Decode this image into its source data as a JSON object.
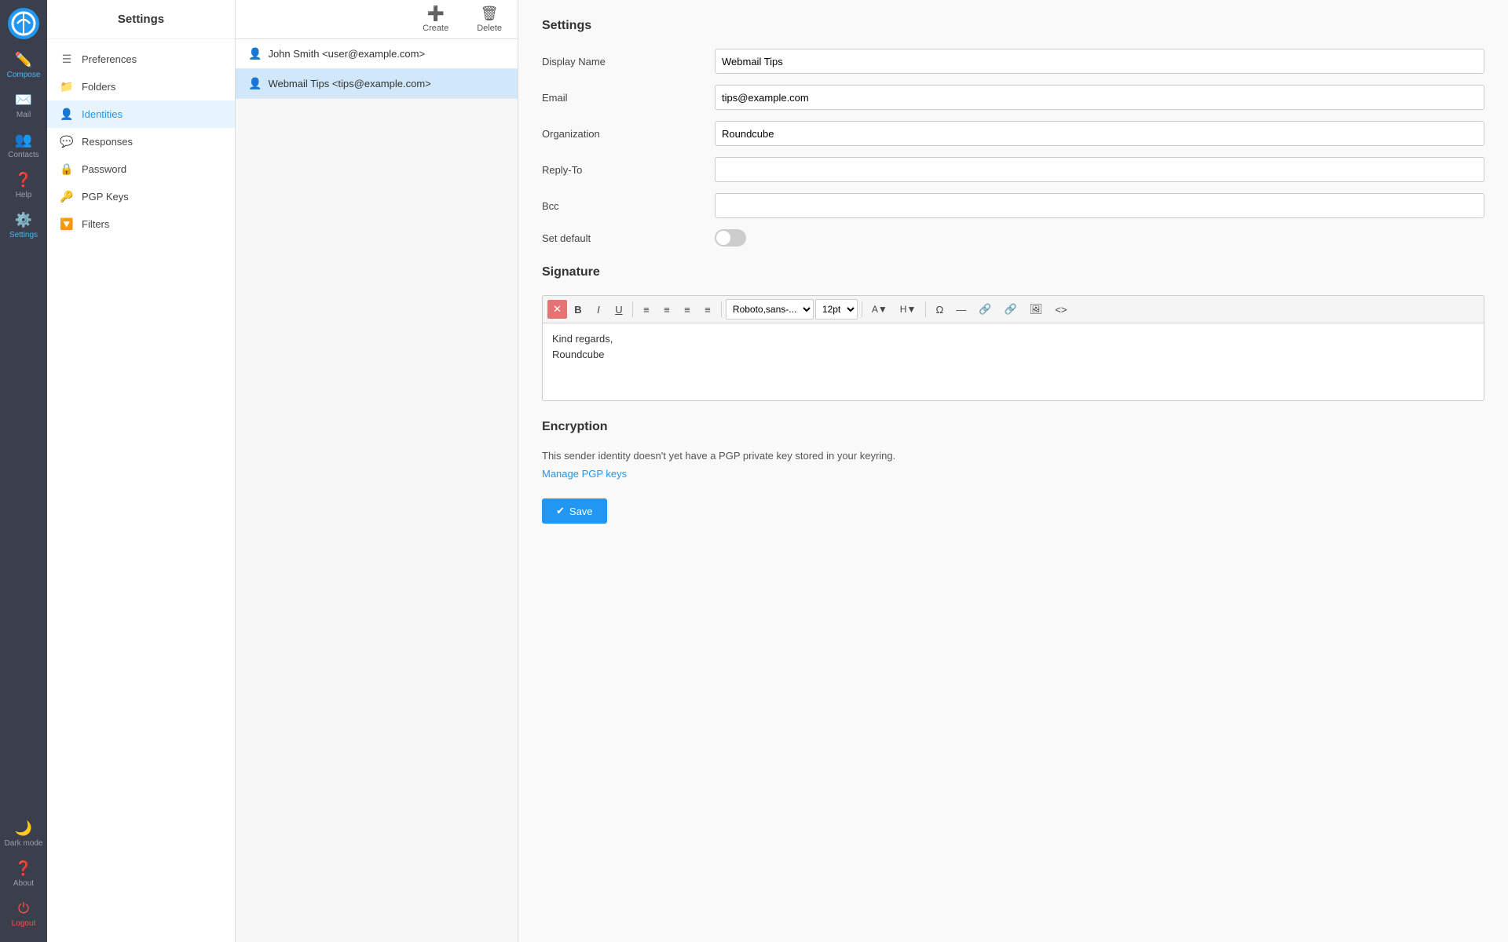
{
  "app": {
    "logo_alt": "Roundcube"
  },
  "left_nav": {
    "items": [
      {
        "id": "compose",
        "label": "Compose",
        "icon": "✏️",
        "active": false
      },
      {
        "id": "mail",
        "label": "Mail",
        "icon": "✉️",
        "active": false
      },
      {
        "id": "contacts",
        "label": "Contacts",
        "icon": "👥",
        "active": false
      },
      {
        "id": "help",
        "label": "Help",
        "icon": "❓",
        "active": false
      },
      {
        "id": "settings",
        "label": "Settings",
        "icon": "⚙️",
        "active": true
      }
    ],
    "bottom_items": [
      {
        "id": "darkmode",
        "label": "Dark mode",
        "icon": "🌙"
      },
      {
        "id": "about",
        "label": "About",
        "icon": "❓"
      },
      {
        "id": "logout",
        "label": "Logout",
        "icon": "⏻"
      }
    ]
  },
  "sidebar": {
    "title": "Settings",
    "menu_items": [
      {
        "id": "preferences",
        "label": "Preferences",
        "icon": "☰",
        "active": false
      },
      {
        "id": "folders",
        "label": "Folders",
        "icon": "📁",
        "active": false
      },
      {
        "id": "identities",
        "label": "Identities",
        "icon": "👤",
        "active": true
      },
      {
        "id": "responses",
        "label": "Responses",
        "icon": "💬",
        "active": false
      },
      {
        "id": "password",
        "label": "Password",
        "icon": "🔒",
        "active": false
      },
      {
        "id": "pgp_keys",
        "label": "PGP Keys",
        "icon": "🔑",
        "active": false
      },
      {
        "id": "filters",
        "label": "Filters",
        "icon": "🔽",
        "active": false
      }
    ]
  },
  "identity_panel": {
    "toolbar": {
      "create_label": "Create",
      "delete_label": "Delete"
    },
    "identities": [
      {
        "id": "john",
        "label": "John Smith <user@example.com>",
        "active": false
      },
      {
        "id": "webmail",
        "label": "Webmail Tips <tips@example.com>",
        "active": true
      }
    ]
  },
  "settings_form": {
    "title": "Settings",
    "fields": {
      "display_name_label": "Display Name",
      "display_name_value": "Webmail Tips",
      "email_label": "Email",
      "email_value": "tips@example.com",
      "organization_label": "Organization",
      "organization_value": "Roundcube",
      "reply_to_label": "Reply-To",
      "reply_to_value": "",
      "bcc_label": "Bcc",
      "bcc_value": "",
      "set_default_label": "Set default",
      "set_default_on": false
    },
    "signature": {
      "title": "Signature",
      "toolbar": {
        "close": "✕",
        "bold": "B",
        "italic": "I",
        "underline": "U",
        "align_left": "≡",
        "align_center": "≡",
        "align_right": "≡",
        "align_justify": "≡",
        "font_family": "Roboto,sans-...",
        "font_size": "12pt",
        "omega": "Ω",
        "hr": "—",
        "link": "🔗",
        "link2": "🔗",
        "image": "🖼",
        "code": "<>"
      },
      "content_line1": "Kind regards,",
      "content_line2": "Roundcube"
    },
    "encryption": {
      "title": "Encryption",
      "note": "This sender identity doesn't yet have a PGP private key stored in your keyring.",
      "manage_pgp_label": "Manage PGP keys"
    },
    "save_button_label": "Save"
  }
}
